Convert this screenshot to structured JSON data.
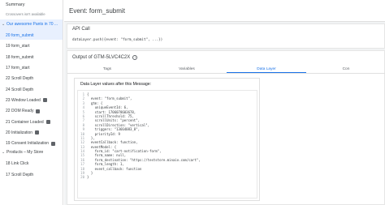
{
  "sidebar": {
    "summary": "Summary",
    "note": "Crossovers isn't available",
    "group1": "Our awesome Pants in 70 ...",
    "items1": [
      {
        "label": "20 form_submit",
        "active": true,
        "badge": false
      },
      {
        "label": "19 form_start",
        "active": false,
        "badge": false
      },
      {
        "label": "18 form_submit",
        "active": false,
        "badge": false
      },
      {
        "label": "17 form_start",
        "active": false,
        "badge": false
      },
      {
        "label": "22 Scroll Depth",
        "active": false,
        "badge": false
      },
      {
        "label": "24 Scroll Depth",
        "active": false,
        "badge": false
      },
      {
        "label": "23 Window Loaded",
        "active": false,
        "badge": true
      },
      {
        "label": "22 DOM Ready",
        "active": false,
        "badge": true
      },
      {
        "label": "21 Container Loaded",
        "active": false,
        "badge": true
      },
      {
        "label": "20 Initialization",
        "active": false,
        "badge": true
      },
      {
        "label": "19 Consent Initialization",
        "active": false,
        "badge": true
      }
    ],
    "group2": "Products – My Store",
    "items2": [
      {
        "label": "18 Link Click",
        "active": false,
        "badge": false
      },
      {
        "label": "17 Scroll Depth",
        "active": false,
        "badge": false
      }
    ]
  },
  "header": {
    "title": "Event: form_submit"
  },
  "api_call": {
    "title": "API Call",
    "code": "dataLayer.push({event: \"form_submit\", ...})"
  },
  "output": {
    "title": "Output of GTM-5LVC4C2X",
    "info_icon": "info-icon",
    "tabs": [
      {
        "label": "Tags",
        "active": false
      },
      {
        "label": "Variables",
        "active": false
      },
      {
        "label": "Data Layer",
        "active": true
      },
      {
        "label": "Con",
        "active": false
      }
    ],
    "data_layer_title": "Data Layer values after this Message:",
    "code_lines": [
      "{",
      "  event: \"form_submit\",",
      "  gtm: {",
      "    uniqueEventId: 6,",
      "    start: 1706078603678,",
      "    scrollThreshold: 75,",
      "    scrollUnits: \"percent\",",
      "    scrollDirection: \"vertical\",",
      "    triggers: \"13664083_8\",",
      "    priorityId: 9",
      "  },",
      "  eventCallback: function,",
      "  eventModel: {",
      "    form_id: \"cart-notification-form\",",
      "    form_name: null,",
      "    form_destination: \"https://teststore.minaio.com/cart\",",
      "    form_length: 1,",
      "    event_callback: function",
      "  }",
      "}"
    ]
  },
  "colors": {
    "accent": "#1a73e8",
    "active_bg": "#e8f0fe",
    "main_bg": "#f1f3f4"
  }
}
